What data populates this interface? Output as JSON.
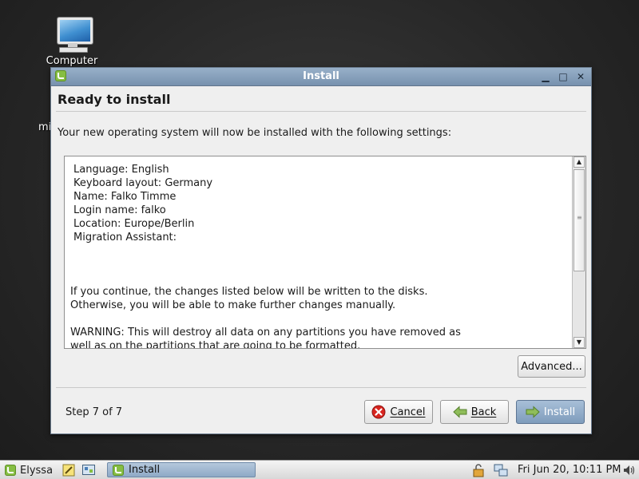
{
  "desktop": {
    "icon_label": "Computer",
    "fragment_label": "mi"
  },
  "window": {
    "title": "Install",
    "heading": "Ready to install",
    "intro": "Your new operating system will now be installed with the following settings:",
    "summary_lines": [
      "Language: English",
      "Keyboard layout: Germany",
      "Name: Falko Timme",
      "Login name: falko",
      "Location: Europe/Berlin",
      "Migration Assistant:"
    ],
    "notice_lines": [
      "If you continue, the changes listed below will be written to the disks.",
      "Otherwise, you will be able to make further changes manually."
    ],
    "warning_lines": [
      "WARNING: This will destroy all data on any partitions you have removed as",
      "well as on the partitions that are going to be formatted."
    ],
    "advanced_label": "Advanced...",
    "step_text": "Step 7 of 7",
    "cancel_label": "Cancel",
    "back_label": "Back",
    "install_label": "Install"
  },
  "taskbar": {
    "menu_label": "Elyssa",
    "task_label": "Install",
    "clock": "Fri Jun 20, 10:11 PM"
  },
  "colors": {
    "titlebar": "#7791ae",
    "mint_green": "#86be43",
    "cancel_red": "#d8251f"
  },
  "icons": {
    "window_app": "mint-logo-icon",
    "minimize": "minimize-icon",
    "maximize": "maximize-icon",
    "close": "close-icon",
    "cancel": "cancel-circle-icon",
    "back": "back-arrow-icon",
    "install": "forward-arrow-icon"
  }
}
